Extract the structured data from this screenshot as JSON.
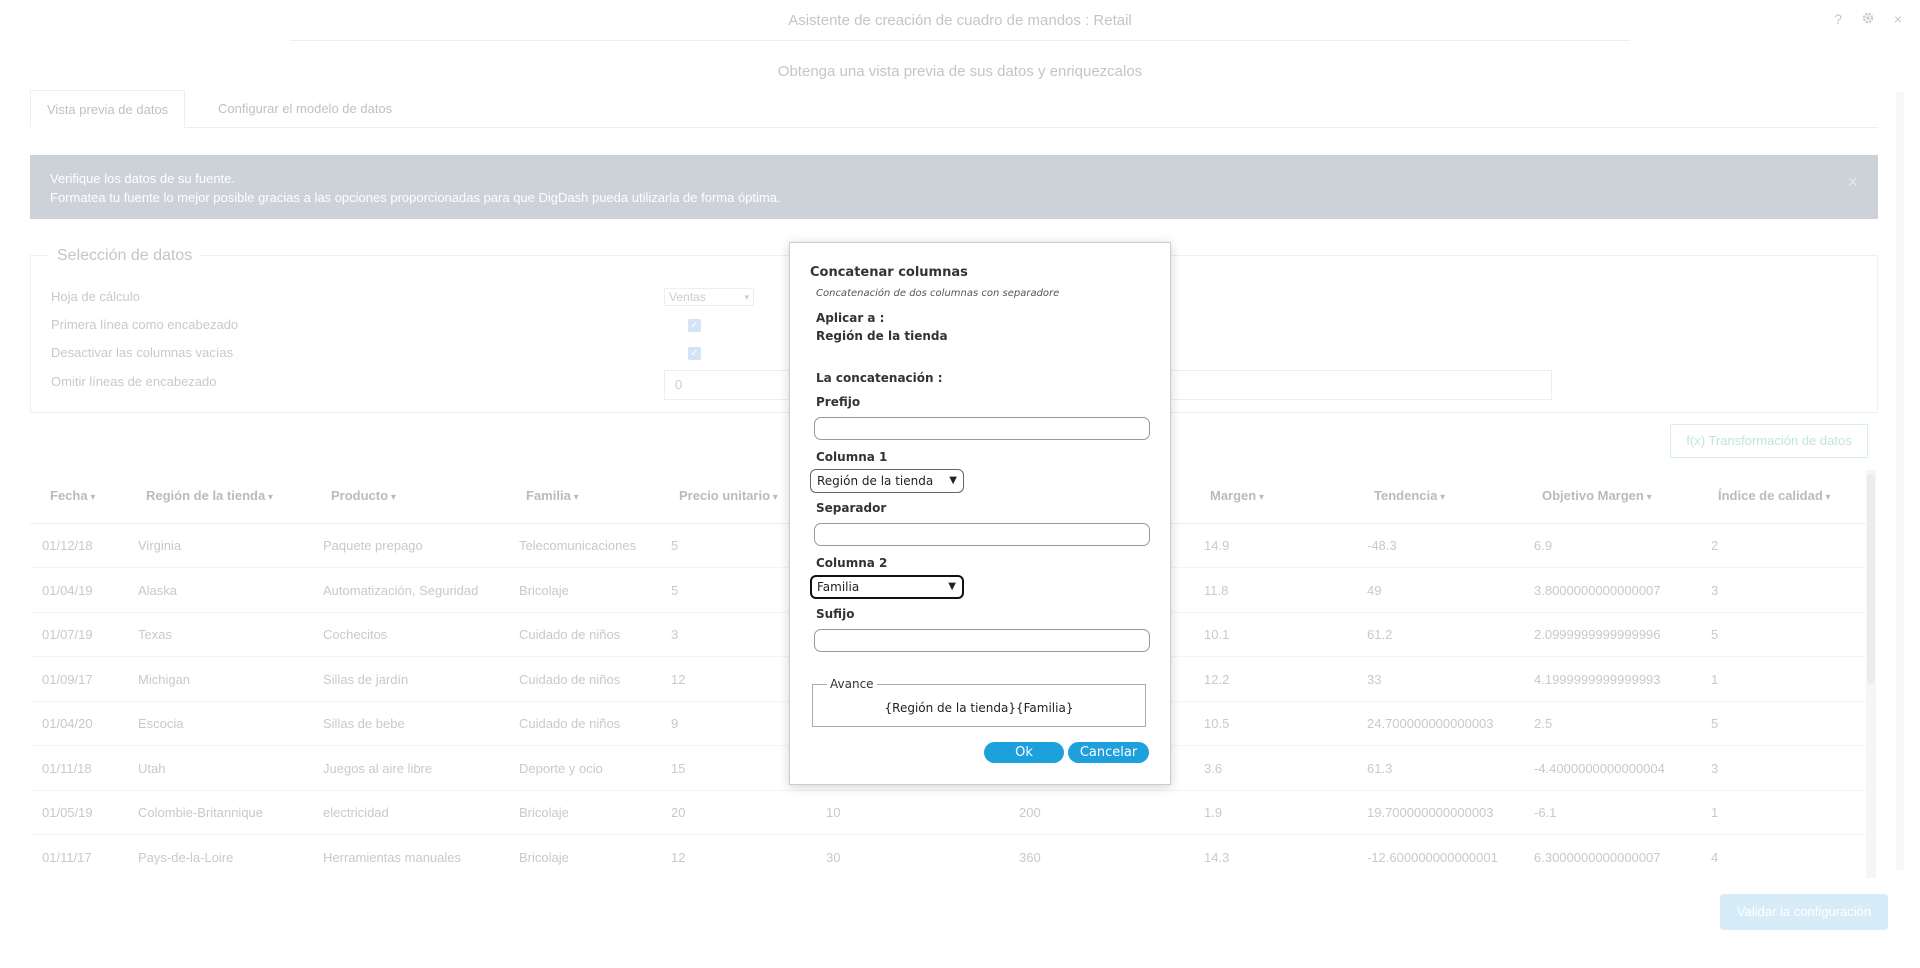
{
  "window": {
    "title": "Asistente de creación de cuadro de mandos : Retail",
    "help_icon": "?",
    "settings_icon": "gear-icon",
    "close_icon": "×"
  },
  "subtitle": "Obtenga una vista previa de sus datos y enriquezcalos",
  "tabs": [
    {
      "label": "Vista previa de datos",
      "active": true
    },
    {
      "label": "Configurar el modelo de datos",
      "active": false
    }
  ],
  "info": {
    "line1": "Verifique los datos de su fuente.",
    "line2": "Formatea tu fuente lo mejor posible gracias a las opciones proporcionadas para que DigDash pueda utilizarla de forma óptima.",
    "close": "×"
  },
  "data_selection": {
    "legend": "Selección de datos",
    "sheet_label": "Hoja de cálculo",
    "sheet_value": "Ventas",
    "first_line_label": "Primera línea como encabezado",
    "disable_empty_label": "Desactivar las columnas vacías",
    "skip_lines_label": "Omitir líneas de encabezado",
    "skip_lines_value": "0"
  },
  "transform_button": "f(x) Transformación de datos",
  "table": {
    "headers": [
      "Fecha",
      "Región de la tienda",
      "Producto",
      "Familia",
      "Precio unitario",
      "Margen",
      "Tendencia",
      "Objetivo Margen",
      "Índice de calidad"
    ],
    "rows": [
      {
        "fecha": "01/12/18",
        "region": "Virginia",
        "producto": "Paquete prepago",
        "familia": "Telecomunicaciones",
        "precio": "5",
        "c6": "",
        "c7": "",
        "margen": "14.9",
        "tendencia": "-48.3",
        "objetivo": "6.9",
        "indice": "2"
      },
      {
        "fecha": "01/04/19",
        "region": "Alaska",
        "producto": "Automatización, Seguridad",
        "familia": "Bricolaje",
        "precio": "5",
        "c6": "",
        "c7": "",
        "margen": "11.8",
        "tendencia": "49",
        "objetivo": "3.8000000000000007",
        "indice": "3"
      },
      {
        "fecha": "01/07/19",
        "region": "Texas",
        "producto": "Cochecitos",
        "familia": "Cuidado de niños",
        "precio": "3",
        "c6": "",
        "c7": "",
        "margen": "10.1",
        "tendencia": "61.2",
        "objetivo": "2.0999999999999996",
        "indice": "5"
      },
      {
        "fecha": "01/09/17",
        "region": "Michigan",
        "producto": "Sillas de jardín",
        "familia": "Cuidado de niños",
        "precio": "12",
        "c6": "",
        "c7": "",
        "margen": "12.2",
        "tendencia": "33",
        "objetivo": "4.1999999999999993",
        "indice": "1"
      },
      {
        "fecha": "01/04/20",
        "region": "Escocia",
        "producto": "Sillas de bebe",
        "familia": "Cuidado de niños",
        "precio": "9",
        "c6": "",
        "c7": "",
        "margen": "10.5",
        "tendencia": "24.700000000000003",
        "objetivo": "2.5",
        "indice": "5"
      },
      {
        "fecha": "01/11/18",
        "region": "Utah",
        "producto": "Juegos al aire libre",
        "familia": "Deporte y ocio",
        "precio": "15",
        "c6": "",
        "c7": "",
        "margen": "3.6",
        "tendencia": "61.3",
        "objetivo": "-4.4000000000000004",
        "indice": "3"
      },
      {
        "fecha": "01/05/19",
        "region": "Colombie-Britannique",
        "producto": "electricidad",
        "familia": "Bricolaje",
        "precio": "20",
        "c6": "10",
        "c7": "200",
        "margen": "1.9",
        "tendencia": "19.700000000000003",
        "objetivo": "-6.1",
        "indice": "1"
      },
      {
        "fecha": "01/11/17",
        "region": "Pays-de-la-Loire",
        "producto": "Herramientas manuales",
        "familia": "Bricolaje",
        "precio": "12",
        "c6": "30",
        "c7": "360",
        "margen": "14.3",
        "tendencia": "-12.600000000000001",
        "objetivo": "6.3000000000000007",
        "indice": "4"
      }
    ]
  },
  "validate_button": "Validar la configuración",
  "modal": {
    "title": "Concatenar columnas",
    "subtitle": "Concatenación de dos columnas con separadore",
    "apply_label": "Aplicar a :",
    "apply_value": "Región de la tienda",
    "concat_label": "La concatenación :",
    "prefix_label": "Prefijo",
    "prefix_value": "",
    "col1_label": "Columna 1",
    "col1_value": "Región de la tienda",
    "separator_label": "Separador",
    "separator_value": "",
    "col2_label": "Columna 2",
    "col2_value": "Familia",
    "suffix_label": "Sufijo",
    "suffix_value": "",
    "preview_legend": "Avance",
    "preview_value": "{Región de la tienda}{Familia}",
    "ok_label": "Ok",
    "cancel_label": "Cancelar"
  }
}
